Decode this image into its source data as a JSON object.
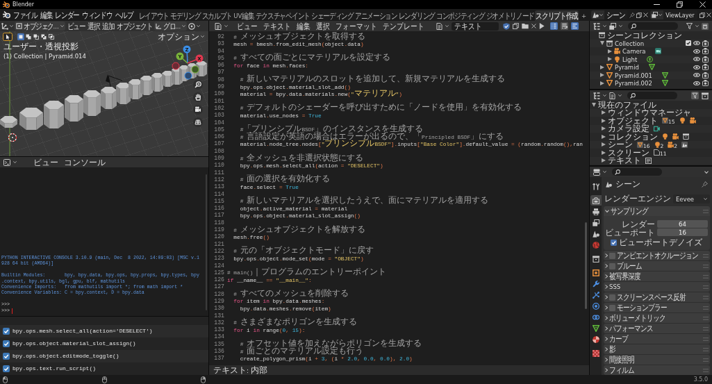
{
  "window": {
    "title": "Blender"
  },
  "menu_bar": [
    "ファイル",
    "編集",
    "レンダー",
    "ウィンドウ",
    "ヘルプ"
  ],
  "workspaces": [
    {
      "label": "レイアウト",
      "selected": false
    },
    {
      "label": "モデリング",
      "selected": false
    },
    {
      "label": "スカルプト",
      "selected": false
    },
    {
      "label": "UV編集",
      "selected": false
    },
    {
      "label": "テクスチャペイント",
      "selected": false
    },
    {
      "label": "シェーディング",
      "selected": false
    },
    {
      "label": "アニメーション",
      "selected": false
    },
    {
      "label": "レンダリング",
      "selected": false
    },
    {
      "label": "コンポジティング",
      "selected": false
    },
    {
      "label": "ジオメトリノード",
      "selected": false
    },
    {
      "label": "スクリプト作成",
      "selected": true
    }
  ],
  "add_workspace": "+",
  "scene": "シーン",
  "view_layer": "ViewLayer",
  "viewport": {
    "mode": "オブジェク...",
    "menus": [
      "ビュー",
      "選択",
      "追加",
      "オブジェクト"
    ],
    "orientation": "グロ...",
    "select_modes": [
      {
        "kind": "set",
        "selected": true
      },
      {
        "kind": "extend",
        "selected": false
      },
      {
        "kind": "subtract",
        "selected": false
      },
      {
        "kind": "invert",
        "selected": false
      },
      {
        "kind": "intersect",
        "selected": false
      }
    ],
    "options": "オプション",
    "view_name": "ユーザー・透視投影",
    "object_info": "(1) Collection | Pyramid.014",
    "gizmo": [
      {
        "kind": "z",
        "label": "Z"
      },
      {
        "kind": "y",
        "label": "Y"
      },
      {
        "kind": "x",
        "label": "X"
      }
    ]
  },
  "console": {
    "menus": [
      "ビュー",
      "コンソール"
    ],
    "blocks": [
      {
        "kind": "banner",
        "lines": [
          "PYTHON INTERACTIVE CONSOLE 3.10.9 (main, Dec  8 2022, 14:09:03) [MSC v.1",
          "928 64 bit (AMD64)]"
        ]
      },
      {
        "kind": "banner",
        "lines": [
          "Builtin Modules:       bpy, bpy.data, bpy.ops, bpy.props, bpy.types, bpy",
          ".context, bpy.utils, bgl, gpu, blf, mathutils",
          "Convenience Imports:   from mathutils import *; from math import *",
          "Convenience Variables: C = bpy.context, D = bpy.data"
        ]
      },
      {
        "kind": "prompt",
        "lines": [
          ">>>",
          ">>>"
        ]
      }
    ]
  },
  "info_log": [
    "bpy.ops.mesh.select_all(action='DESELECT')",
    "bpy.ops.object.material_slot_assign()",
    "bpy.ops.object.editmode_toggle()",
    "bpy.ops.text.run_script()"
  ],
  "text_editor": {
    "menus": [
      "ビュー",
      "テキスト",
      "編集",
      "選択",
      "フォーマット",
      "テンプレート"
    ],
    "text_name": "テキスト",
    "fake_user": true,
    "toggles": [
      {
        "kind": "line_numbers",
        "on": true
      },
      {
        "kind": "word_wrap",
        "on": false
      },
      {
        "kind": "syntax",
        "on": true
      }
    ],
    "lines": [
      {
        "number": "92",
        "tokens": [
          {
            "kind": "comment",
            "text": "  # メッシュオブジェクトを取得する"
          }
        ]
      },
      {
        "number": "93",
        "tokens": [
          {
            "kind": "name",
            "text": "  mesh "
          },
          {
            "kind": "op",
            "text": "="
          },
          {
            "kind": "name",
            "text": " bmesh"
          },
          {
            "kind": "op",
            "text": "."
          },
          {
            "kind": "name",
            "text": "from_edit_mesh"
          },
          {
            "kind": "op",
            "text": "("
          },
          {
            "kind": "name",
            "text": "object"
          },
          {
            "kind": "op",
            "text": "."
          },
          {
            "kind": "name",
            "text": "data"
          },
          {
            "kind": "op",
            "text": ")"
          }
        ]
      },
      {
        "number": "94"
      },
      {
        "number": "95",
        "tokens": [
          {
            "kind": "comment",
            "text": "  # すべての面ごとにマテリアルを設定する"
          }
        ]
      },
      {
        "number": "96",
        "tokens": [
          {
            "kind": "keyword",
            "text": "  for"
          },
          {
            "kind": "name",
            "text": " face "
          },
          {
            "kind": "keyword",
            "text": "in"
          },
          {
            "kind": "name",
            "text": " mesh"
          },
          {
            "kind": "op",
            "text": "."
          },
          {
            "kind": "name",
            "text": "faces"
          },
          {
            "kind": "op",
            "text": ":"
          }
        ]
      },
      {
        "number": "97"
      },
      {
        "number": "98",
        "tokens": [
          {
            "kind": "comment",
            "text": "    # 新しいマテリアルのスロットを追加して、新規マテリアルを生成する"
          }
        ]
      },
      {
        "number": "99",
        "tokens": [
          {
            "kind": "name",
            "text": "    bpy"
          },
          {
            "kind": "op",
            "text": "."
          },
          {
            "kind": "name",
            "text": "ops"
          },
          {
            "kind": "op",
            "text": "."
          },
          {
            "kind": "name",
            "text": "object"
          },
          {
            "kind": "op",
            "text": "."
          },
          {
            "kind": "name",
            "text": "material_slot_add"
          },
          {
            "kind": "op",
            "text": "()"
          }
        ]
      },
      {
        "number": "100",
        "tokens": [
          {
            "kind": "name",
            "text": "    material "
          },
          {
            "kind": "op",
            "text": "="
          },
          {
            "kind": "name",
            "text": " bpy"
          },
          {
            "kind": "op",
            "text": "."
          },
          {
            "kind": "name",
            "text": "data"
          },
          {
            "kind": "op",
            "text": "."
          },
          {
            "kind": "name",
            "text": "materials"
          },
          {
            "kind": "op",
            "text": "."
          },
          {
            "kind": "name",
            "text": "new"
          },
          {
            "kind": "op",
            "text": "("
          },
          {
            "kind": "string",
            "text": "\"マテリアル\""
          },
          {
            "kind": "op",
            "text": ")"
          }
        ]
      },
      {
        "number": "101"
      },
      {
        "number": "102",
        "tokens": [
          {
            "kind": "comment",
            "text": "    # デフォルトのシェーダーを呼び出すために「ノードを使用」を有効化する"
          }
        ]
      },
      {
        "number": "103",
        "tokens": [
          {
            "kind": "name",
            "text": "    material"
          },
          {
            "kind": "op",
            "text": "."
          },
          {
            "kind": "name",
            "text": "use_nodes "
          },
          {
            "kind": "op",
            "text": "= "
          },
          {
            "kind": "constant",
            "text": "True"
          }
        ]
      },
      {
        "number": "104"
      },
      {
        "number": "105",
        "tokens": [
          {
            "kind": "comment",
            "text": "    #「プリンシプルBSDF」のインスタンスを生成する"
          }
        ]
      },
      {
        "number": "106",
        "tokens": [
          {
            "kind": "comment",
            "text": "    # 言語設定が英語の場合はエラーが出るので、「Principled BSDF」にする"
          }
        ]
      },
      {
        "number": "107",
        "tokens": [
          {
            "kind": "name",
            "text": "    material"
          },
          {
            "kind": "op",
            "text": "."
          },
          {
            "kind": "name",
            "text": "node_tree"
          },
          {
            "kind": "op",
            "text": "."
          },
          {
            "kind": "name",
            "text": "nodes"
          },
          {
            "kind": "op",
            "text": "["
          },
          {
            "kind": "string",
            "text": "\"プリンシプルBSDF\""
          },
          {
            "kind": "op",
            "text": "]."
          },
          {
            "kind": "name",
            "text": "inputs"
          },
          {
            "kind": "op",
            "text": "["
          },
          {
            "kind": "string",
            "text": "\"Base Color\""
          },
          {
            "kind": "op",
            "text": "]."
          },
          {
            "kind": "name",
            "text": "default_value "
          },
          {
            "kind": "op",
            "text": "= ("
          },
          {
            "kind": "name",
            "text": "random"
          },
          {
            "kind": "op",
            "text": "."
          },
          {
            "kind": "name",
            "text": "random"
          },
          {
            "kind": "op",
            "text": "(),"
          },
          {
            "kind": "name",
            "text": "ran"
          }
        ]
      },
      {
        "number": "108"
      },
      {
        "number": "109",
        "tokens": [
          {
            "kind": "comment",
            "text": "    # 全メッシュを非選択状態にする"
          }
        ]
      },
      {
        "number": "110",
        "tokens": [
          {
            "kind": "name",
            "text": "    bpy"
          },
          {
            "kind": "op",
            "text": "."
          },
          {
            "kind": "name",
            "text": "ops"
          },
          {
            "kind": "op",
            "text": "."
          },
          {
            "kind": "name",
            "text": "mesh"
          },
          {
            "kind": "op",
            "text": "."
          },
          {
            "kind": "name",
            "text": "select_all"
          },
          {
            "kind": "op",
            "text": "("
          },
          {
            "kind": "name",
            "text": "action "
          },
          {
            "kind": "op",
            "text": "= "
          },
          {
            "kind": "string",
            "text": "\"DESELECT\""
          },
          {
            "kind": "op",
            "text": ")"
          }
        ]
      },
      {
        "number": "111"
      },
      {
        "number": "112",
        "tokens": [
          {
            "kind": "comment",
            "text": "    # 面の選択を有効化する"
          }
        ]
      },
      {
        "number": "113",
        "tokens": [
          {
            "kind": "name",
            "text": "    face"
          },
          {
            "kind": "op",
            "text": "."
          },
          {
            "kind": "name",
            "text": "select "
          },
          {
            "kind": "op",
            "text": "= "
          },
          {
            "kind": "constant",
            "text": "True"
          }
        ]
      },
      {
        "number": "114"
      },
      {
        "number": "115",
        "tokens": [
          {
            "kind": "comment",
            "text": "    # 新しいマテリアルを選択したうえで、面にマテリアルを適用する"
          }
        ]
      },
      {
        "number": "116",
        "tokens": [
          {
            "kind": "name",
            "text": "    object"
          },
          {
            "kind": "op",
            "text": "."
          },
          {
            "kind": "name",
            "text": "active_material "
          },
          {
            "kind": "op",
            "text": "="
          },
          {
            "kind": "name",
            "text": " material"
          }
        ]
      },
      {
        "number": "117",
        "tokens": [
          {
            "kind": "name",
            "text": "    bpy"
          },
          {
            "kind": "op",
            "text": "."
          },
          {
            "kind": "name",
            "text": "ops"
          },
          {
            "kind": "op",
            "text": "."
          },
          {
            "kind": "name",
            "text": "object"
          },
          {
            "kind": "op",
            "text": "."
          },
          {
            "kind": "name",
            "text": "material_slot_assign"
          },
          {
            "kind": "op",
            "text": "()"
          }
        ]
      },
      {
        "number": "118"
      },
      {
        "number": "119",
        "tokens": [
          {
            "kind": "comment",
            "text": "  # メッシュオブジェクトを解放する"
          }
        ]
      },
      {
        "number": "120",
        "tokens": [
          {
            "kind": "name",
            "text": "  mesh"
          },
          {
            "kind": "op",
            "text": "."
          },
          {
            "kind": "name",
            "text": "free"
          },
          {
            "kind": "op",
            "text": "()"
          }
        ]
      },
      {
        "number": "121"
      },
      {
        "number": "122",
        "tokens": [
          {
            "kind": "comment",
            "text": "  # 元の「オブジェクトモード」に戻す"
          }
        ]
      },
      {
        "number": "123",
        "tokens": [
          {
            "kind": "name",
            "text": "  bpy"
          },
          {
            "kind": "op",
            "text": "."
          },
          {
            "kind": "name",
            "text": "ops"
          },
          {
            "kind": "op",
            "text": "."
          },
          {
            "kind": "name",
            "text": "object"
          },
          {
            "kind": "op",
            "text": "."
          },
          {
            "kind": "name",
            "text": "mode_set"
          },
          {
            "kind": "op",
            "text": "("
          },
          {
            "kind": "name",
            "text": "mode "
          },
          {
            "kind": "op",
            "text": "= "
          },
          {
            "kind": "string",
            "text": "\"OBJECT\""
          },
          {
            "kind": "op",
            "text": ")"
          }
        ]
      },
      {
        "number": "124"
      },
      {
        "number": "125",
        "tokens": [
          {
            "kind": "comment",
            "text": "# main()｜プログラムのエントリーポイント"
          }
        ]
      },
      {
        "number": "126",
        "tokens": [
          {
            "kind": "keyword",
            "text": "if"
          },
          {
            "kind": "name",
            "text": " __name__ "
          },
          {
            "kind": "op",
            "text": "== "
          },
          {
            "kind": "string",
            "text": "\"__main__\""
          },
          {
            "kind": "op",
            "text": ":"
          }
        ]
      },
      {
        "number": "127"
      },
      {
        "number": "128",
        "tokens": [
          {
            "kind": "comment",
            "text": "  # すべてのメッシュを削除する"
          }
        ]
      },
      {
        "number": "129",
        "tokens": [
          {
            "kind": "keyword",
            "text": "  for"
          },
          {
            "kind": "name",
            "text": " item "
          },
          {
            "kind": "keyword",
            "text": "in"
          },
          {
            "kind": "name",
            "text": " bpy"
          },
          {
            "kind": "op",
            "text": "."
          },
          {
            "kind": "name",
            "text": "data"
          },
          {
            "kind": "op",
            "text": "."
          },
          {
            "kind": "name",
            "text": "meshes"
          },
          {
            "kind": "op",
            "text": ":"
          }
        ]
      },
      {
        "number": "130",
        "tokens": [
          {
            "kind": "name",
            "text": "    bpy"
          },
          {
            "kind": "op",
            "text": "."
          },
          {
            "kind": "name",
            "text": "data"
          },
          {
            "kind": "op",
            "text": "."
          },
          {
            "kind": "name",
            "text": "meshes"
          },
          {
            "kind": "op",
            "text": "."
          },
          {
            "kind": "name",
            "text": "remove"
          },
          {
            "kind": "op",
            "text": "("
          },
          {
            "kind": "name",
            "text": "item"
          },
          {
            "kind": "op",
            "text": ")"
          }
        ]
      },
      {
        "number": "131"
      },
      {
        "number": "132",
        "tokens": [
          {
            "kind": "comment",
            "text": "  # さまざまなポリゴンを生成する"
          }
        ]
      },
      {
        "number": "133",
        "tokens": [
          {
            "kind": "keyword",
            "text": "  for"
          },
          {
            "kind": "name",
            "text": " i "
          },
          {
            "kind": "keyword",
            "text": "in"
          },
          {
            "kind": "name",
            "text": " range"
          },
          {
            "kind": "op",
            "text": "("
          },
          {
            "kind": "number",
            "text": "0"
          },
          {
            "kind": "op",
            "text": ", "
          },
          {
            "kind": "number",
            "text": "15"
          },
          {
            "kind": "op",
            "text": "):"
          }
        ]
      },
      {
        "number": "134"
      },
      {
        "number": "135",
        "tokens": [
          {
            "kind": "comment",
            "text": "    # オフセット値を加えながらポリゴンを生成する"
          }
        ]
      },
      {
        "number": "136",
        "tokens": [
          {
            "kind": "comment",
            "text": "    # 面ごとのマテリアル設定も行う"
          }
        ]
      },
      {
        "number": "137",
        "tokens": [
          {
            "kind": "name",
            "text": "    create_polygon_prism"
          },
          {
            "kind": "op",
            "text": "("
          },
          {
            "kind": "name",
            "text": "i "
          },
          {
            "kind": "op",
            "text": "+ "
          },
          {
            "kind": "number",
            "text": "3"
          },
          {
            "kind": "op",
            "text": ", ("
          },
          {
            "kind": "name",
            "text": "i "
          },
          {
            "kind": "op",
            "text": "* "
          },
          {
            "kind": "number",
            "text": "2.0"
          },
          {
            "kind": "op",
            "text": ", "
          },
          {
            "kind": "number",
            "text": "0.0"
          },
          {
            "kind": "op",
            "text": ", "
          },
          {
            "kind": "number",
            "text": "0.0"
          },
          {
            "kind": "op",
            "text": "), "
          },
          {
            "kind": "number",
            "text": "2.0"
          },
          {
            "kind": "op",
            "text": ")"
          }
        ]
      }
    ],
    "status": "テキスト: 内部"
  },
  "outliner": {
    "items": [
      {
        "label": "シーンコレクション",
        "kind": "scene_collection",
        "children": [
          {
            "label": "Collection",
            "kind": "collection",
            "expanded": true,
            "checked": true,
            "children": [
              {
                "label": "Camera",
                "kind": "camera",
                "expanded": false
              },
              {
                "label": "Light",
                "kind": "light",
                "expanded": false
              }
            ]
          },
          {
            "label": "Pyramid",
            "kind": "mesh",
            "expanded": false
          },
          {
            "label": "Pyramid.001",
            "kind": "mesh",
            "expanded": false
          },
          {
            "label": "Pyramid.002",
            "kind": "mesh",
            "expanded": false
          }
        ]
      }
    ]
  },
  "blend_file": {
    "items": [
      {
        "label": "現在のファイル",
        "expanded": true,
        "children": [
          {
            "label": "ウィンドウマネージャ",
            "expanded": false
          },
          {
            "label": "オブジェクト",
            "expanded": false,
            "icons": [
              {
                "kind": "mesh_object",
                "count": "15"
              },
              {
                "kind": "light"
              },
              {
                "kind": "camera"
              }
            ]
          },
          {
            "label": "カメラ設定",
            "expanded": false,
            "icons": [
              {
                "kind": "camera_data"
              }
            ]
          },
          {
            "label": "コレクション",
            "expanded": false,
            "icons": [
              {
                "kind": "light"
              },
              {
                "kind": "camera"
              },
              {
                "kind": "collection"
              }
            ]
          },
          {
            "label": "シーン",
            "expanded": false,
            "icons": [
              {
                "kind": "mesh_object",
                "count": "16"
              },
              {
                "kind": "light",
                "count": "2"
              },
              {
                "kind": "camera",
                "count": "2"
              },
              {
                "kind": "scene"
              }
            ]
          },
          {
            "label": "スクリーン",
            "expanded": false,
            "icons": [
              {
                "kind": "screen",
                "count": "11"
              }
            ]
          },
          {
            "label": "テキスト",
            "expanded": false,
            "icons": [
              {
                "kind": "text"
              }
            ]
          }
        ]
      }
    ]
  },
  "properties": {
    "tab_groups": [
      [
        {
          "kind": "tool",
          "selected": false
        }
      ],
      [
        {
          "kind": "render",
          "selected": true
        },
        {
          "kind": "output",
          "selected": false
        },
        {
          "kind": "view_layer",
          "selected": false
        },
        {
          "kind": "scene",
          "selected": false
        },
        {
          "kind": "world",
          "selected": false
        }
      ],
      [
        {
          "kind": "collection",
          "selected": false
        }
      ],
      [
        {
          "kind": "object",
          "selected": false
        },
        {
          "kind": "modifiers",
          "selected": false
        },
        {
          "kind": "particles",
          "selected": false
        },
        {
          "kind": "physics",
          "selected": false
        },
        {
          "kind": "constraints",
          "selected": false
        },
        {
          "kind": "data",
          "selected": false
        },
        {
          "kind": "material",
          "selected": false
        }
      ],
      [
        {
          "kind": "texture",
          "selected": false
        }
      ]
    ],
    "context": "シーン",
    "render_engine": {
      "label": "レンダーエンジン",
      "value": "Eevee"
    },
    "panels": [
      {
        "title": "サンプリング",
        "expanded": true,
        "fields": [
          {
            "label": "レンダー",
            "value": "64"
          },
          {
            "label": "ビューポート",
            "value": "16"
          }
        ],
        "option": {
          "label": "ビューポートデノイズ",
          "checked": true
        }
      },
      {
        "title": "アンビエントオクルージョン",
        "expanded": false,
        "checked": false
      },
      {
        "title": "ブルーム",
        "expanded": false,
        "checked": false
      },
      {
        "title": "被写界深度",
        "expanded": false
      },
      {
        "title": "SSS",
        "expanded": false
      },
      {
        "title": "スクリーンスペース反射",
        "expanded": false,
        "checked": false
      },
      {
        "title": "モーションブラー",
        "expanded": false,
        "checked": false
      },
      {
        "title": "ボリューメトリック",
        "expanded": false
      },
      {
        "title": "パフォーマンス",
        "expanded": false
      },
      {
        "title": "カーブ",
        "expanded": false
      },
      {
        "title": "影",
        "expanded": false
      },
      {
        "title": "間接照明",
        "expanded": false
      },
      {
        "title": "フィルム",
        "expanded": false
      }
    ]
  },
  "status_bar": {
    "version": "3.5.0"
  }
}
